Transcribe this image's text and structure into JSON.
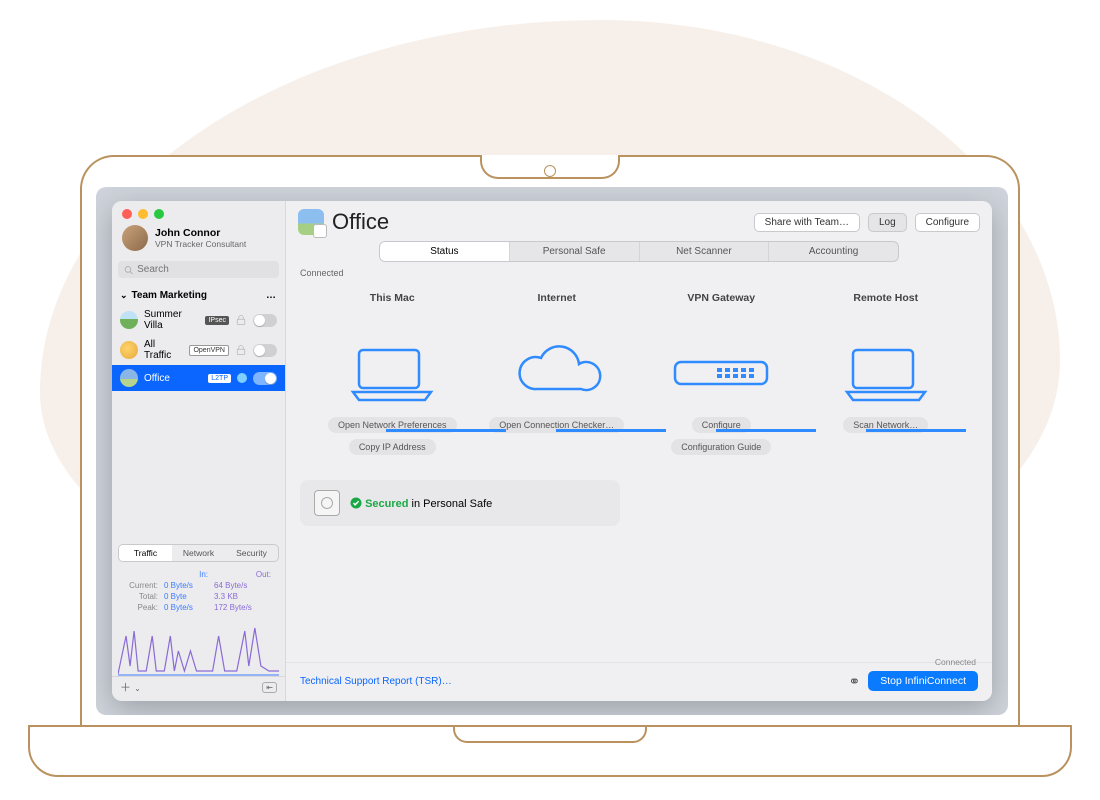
{
  "sidebar": {
    "user": {
      "name": "John Connor",
      "role": "VPN Tracker Consultant"
    },
    "search_placeholder": "Search",
    "group": {
      "label": "Team Marketing"
    },
    "items": [
      {
        "name": "Summer Villa",
        "badge": "IPsec",
        "protocol_style": "dark",
        "locked": true,
        "on": false
      },
      {
        "name": "All Traffic",
        "badge": "OpenVPN",
        "protocol_style": "outline",
        "locked": true,
        "on": false
      },
      {
        "name": "Office",
        "badge": "L2TP",
        "protocol_style": "selected",
        "locked": false,
        "on": true,
        "selected": true
      }
    ],
    "bottom_tabs": [
      "Traffic",
      "Network",
      "Security"
    ],
    "bottom_tab_active": 0,
    "stats": {
      "headers": [
        "",
        "In:",
        "Out:"
      ],
      "rows": [
        [
          "Current:",
          "0 Byte/s",
          "64 Byte/s"
        ],
        [
          "Total:",
          "0 Byte",
          "3.3 KB"
        ],
        [
          "Peak:",
          "0 Byte/s",
          "172 Byte/s"
        ]
      ]
    }
  },
  "main": {
    "title": "Office",
    "toolbar": {
      "share": "Share with Team…",
      "log": "Log",
      "configure": "Configure"
    },
    "tabs": [
      "Status",
      "Personal Safe",
      "Net Scanner",
      "Accounting"
    ],
    "active_tab": 0,
    "status_text": "Connected",
    "nodes": [
      {
        "label": "This Mac",
        "actions": [
          "Open Network Preferences",
          "Copy IP Address"
        ]
      },
      {
        "label": "Internet",
        "actions": [
          "Open Connection Checker…"
        ]
      },
      {
        "label": "VPN Gateway",
        "actions": [
          "Configure",
          "Configuration Guide"
        ]
      },
      {
        "label": "Remote Host",
        "actions": [
          "Scan Network…"
        ]
      }
    ],
    "secured": {
      "strong": "Secured",
      "rest": " in Personal Safe"
    },
    "footer": {
      "tsr": "Technical Support Report (TSR)…",
      "conn_status": "Connected",
      "stop": "Stop InfiniConnect"
    }
  }
}
